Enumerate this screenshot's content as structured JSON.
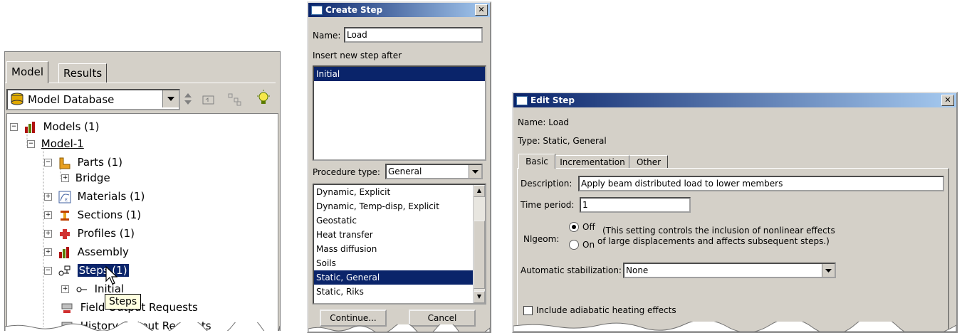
{
  "tree_panel": {
    "tabs": [
      "Model",
      "Results"
    ],
    "database_label": "Model Database",
    "nodes": {
      "models": "Models (1)",
      "model1": "Model-1",
      "parts": "Parts (1)",
      "bridge": "Bridge",
      "materials": "Materials (1)",
      "sections": "Sections (1)",
      "profiles": "Profiles (1)",
      "assembly": "Assembly",
      "steps": "Steps (1)",
      "initial": "Initial",
      "field_output": "Field Output Requests",
      "history_output": "History Output Requests"
    },
    "tooltip": "Steps"
  },
  "create_step": {
    "title": "Create Step",
    "name_label": "Name:",
    "name_value": "Load",
    "insert_label": "Insert new step after",
    "insert_items": [
      "Initial"
    ],
    "procedure_label": "Procedure type:",
    "procedure_value": "General",
    "procedures": [
      "Dynamic, Explicit",
      "Dynamic, Temp-disp, Explicit",
      "Geostatic",
      "Heat transfer",
      "Mass diffusion",
      "Soils",
      "Static, General",
      "Static, Riks"
    ],
    "selected_procedure": "Static, General",
    "continue_label": "Continue...",
    "cancel_label": "Cancel"
  },
  "edit_step": {
    "title": "Edit Step",
    "name_line": "Name:  Load",
    "type_line": "Type:  Static, General",
    "tabs": [
      "Basic",
      "Incrementation",
      "Other"
    ],
    "description_label": "Description:",
    "description_value": "Apply beam distributed load to lower members",
    "time_label": "Time period:",
    "time_value": "1",
    "nlgeom_label": "Nlgeom:",
    "off_label": "Off",
    "on_label": "On",
    "nlgeom_note_1": "(This setting controls the inclusion of nonlinear effects",
    "nlgeom_note_2": "of large displacements and affects subsequent steps.)",
    "stabilization_label": "Automatic stabilization:",
    "stabilization_value": "None",
    "adiabatic_label": "Include adiabatic heating effects"
  },
  "colors": {
    "selection": "#0a246a",
    "dialog_bg": "#d4d0c8",
    "tooltip_bg": "#ffffe1"
  }
}
